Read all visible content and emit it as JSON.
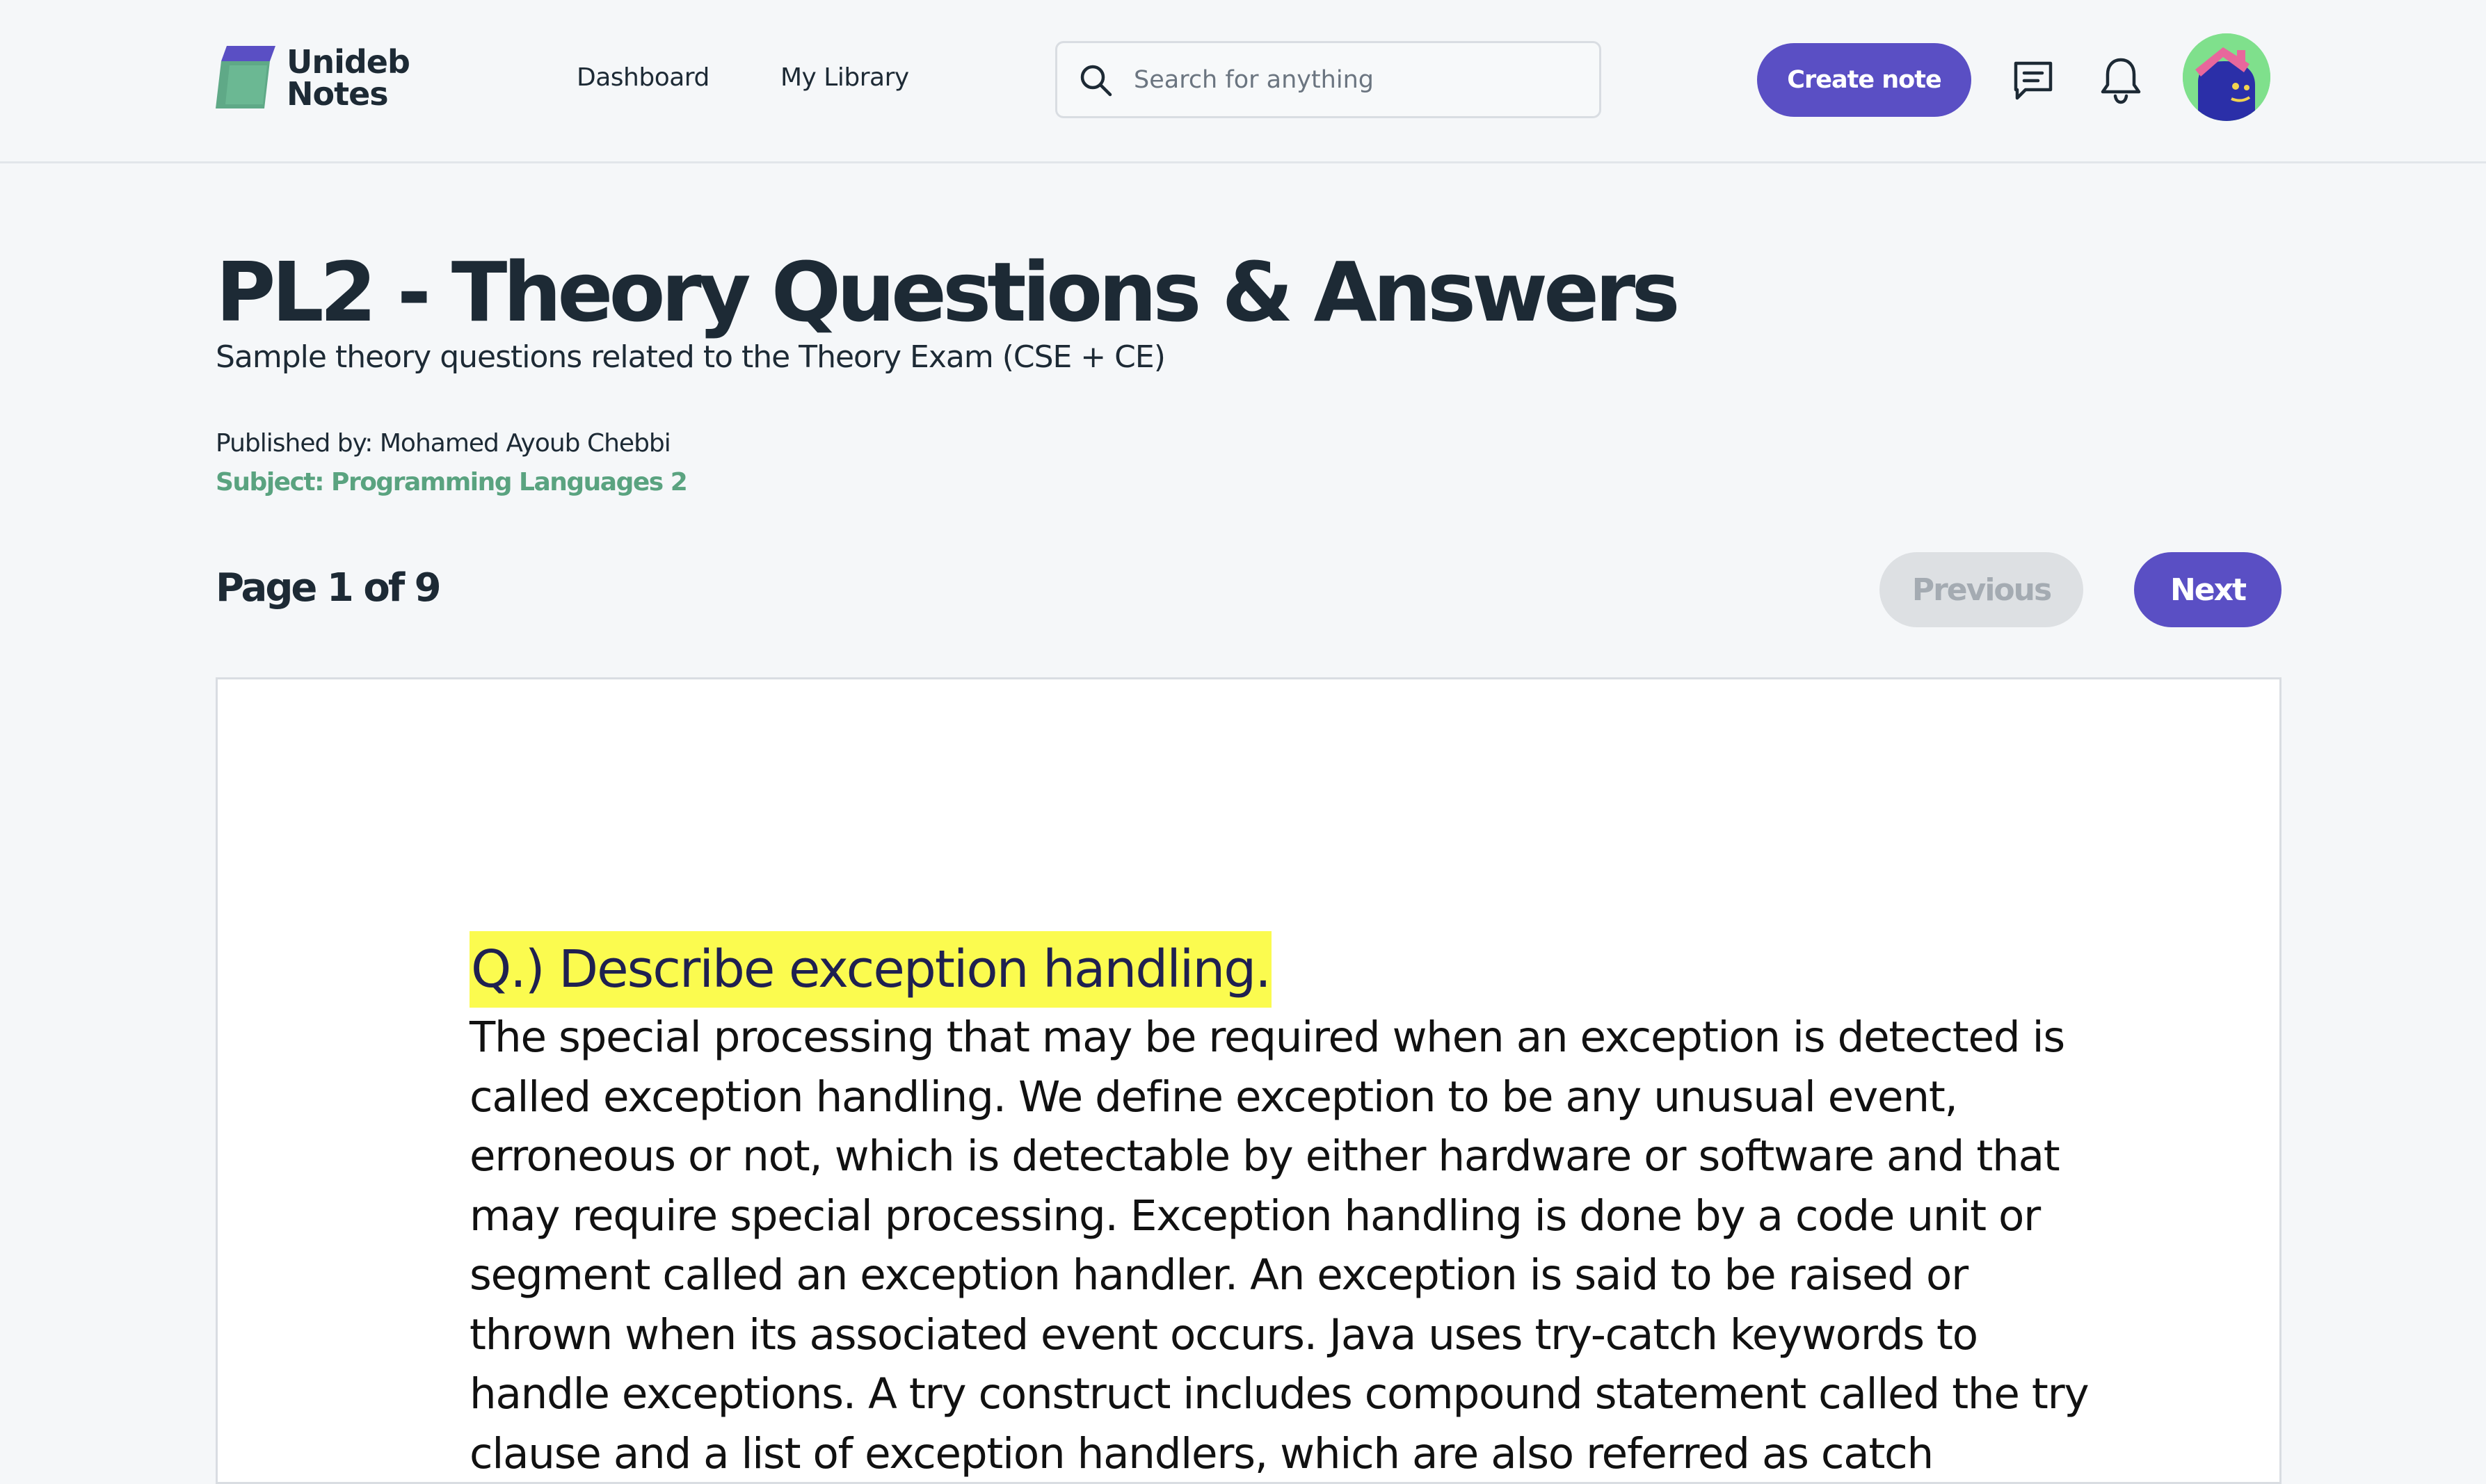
{
  "header": {
    "logo": {
      "line1": "Unideb",
      "line2": "Notes"
    },
    "nav": [
      {
        "label": "Dashboard"
      },
      {
        "label": "My Library"
      }
    ],
    "search": {
      "placeholder": "Search for anything",
      "value": "",
      "icon": "search-icon"
    },
    "create_button": "Create note",
    "icons": [
      "message-icon",
      "bell-icon"
    ],
    "avatar": "user-avatar"
  },
  "document": {
    "title": "PL2 - Theory Questions & Answers",
    "subtitle": "Sample theory questions related to the Theory Exam (CSE + CE)",
    "published_by": "Published by: Mohamed Ayoub Chebbi",
    "subject": "Subject: Programming Languages 2"
  },
  "pagination": {
    "counter": "Page 1 of 9",
    "previous_label": "Previous",
    "next_label": "Next",
    "current_page": 1,
    "total_pages": 9
  },
  "page_content": {
    "question": "Q.) Describe exception handling.",
    "answer_lines": [
      "The special processing that may be required when an exception is detected is",
      "called exception handling. We define exception to be any unusual event,",
      "erroneous or not, which is detectable by either hardware or software and that",
      "may require special processing. Exception handling is done by a code unit or",
      "segment called an exception handler. An exception is said to be raised or",
      "thrown when its associated event occurs. Java uses try-catch keywords to",
      "handle exceptions. A try construct includes compound statement called the try",
      "clause and a list of exception handlers, which are also referred as catch"
    ]
  },
  "colors": {
    "accent": "#5a4fc4",
    "subject_green": "#5aa380",
    "highlight": "#fbfb4f",
    "background": "#f5f7f9"
  }
}
